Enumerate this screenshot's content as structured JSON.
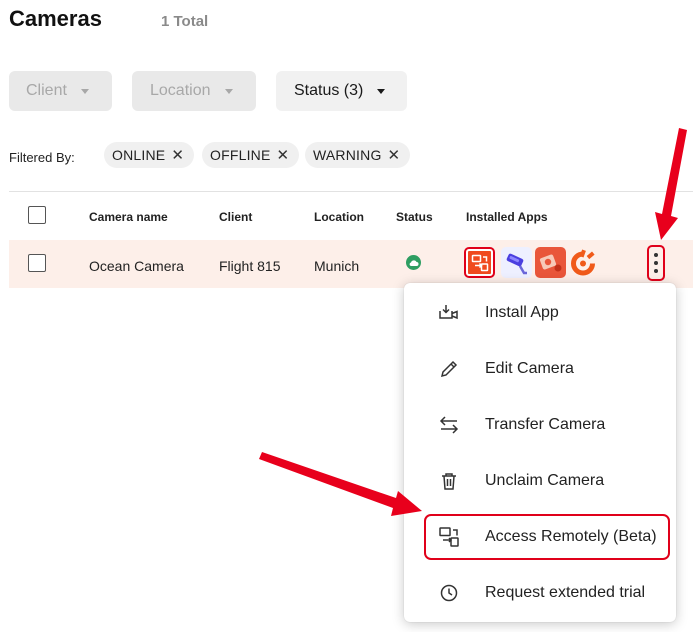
{
  "header": {
    "title": "Cameras",
    "total": "1 Total"
  },
  "filters": {
    "client_label": "Client",
    "location_label": "Location",
    "status_label": "Status (3)",
    "filtered_by_label": "Filtered By:",
    "chips": [
      "ONLINE",
      "OFFLINE",
      "WARNING"
    ]
  },
  "table": {
    "columns": [
      "Camera name",
      "Client",
      "Location",
      "Status",
      "Installed Apps"
    ],
    "rows": [
      {
        "camera_name": "Ocean Camera",
        "client": "Flight 815",
        "location": "Munich",
        "status": "online"
      }
    ]
  },
  "menu": {
    "items": [
      {
        "label": "Install App",
        "icon": "install-app-icon"
      },
      {
        "label": "Edit Camera",
        "icon": "pencil-icon"
      },
      {
        "label": "Transfer Camera",
        "icon": "transfer-arrows-icon"
      },
      {
        "label": "Unclaim Camera",
        "icon": "trash-icon"
      },
      {
        "label": "Access Remotely (Beta)",
        "icon": "remote-access-icon"
      },
      {
        "label": "Request extended trial",
        "icon": "clock-icon"
      }
    ]
  },
  "colors": {
    "highlight": "#e0001a",
    "row_bg": "#fdefe9",
    "online": "#2e9e62"
  }
}
